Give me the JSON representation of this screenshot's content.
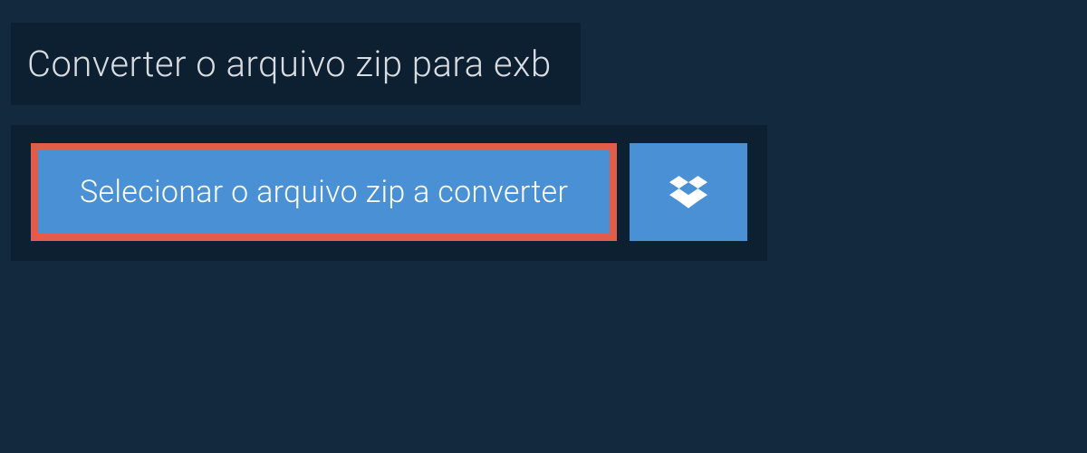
{
  "header": {
    "title": "Converter o arquivo zip para exb"
  },
  "actions": {
    "select_file_label": "Selecionar o arquivo zip a converter",
    "dropbox_label": "Dropbox"
  },
  "colors": {
    "page_bg": "#13293d",
    "panel_bg": "#0c2032",
    "button_bg": "#4990d5",
    "highlight_border": "#e25c4a",
    "text_light": "#d9dde1",
    "text_white": "#ffffff"
  }
}
